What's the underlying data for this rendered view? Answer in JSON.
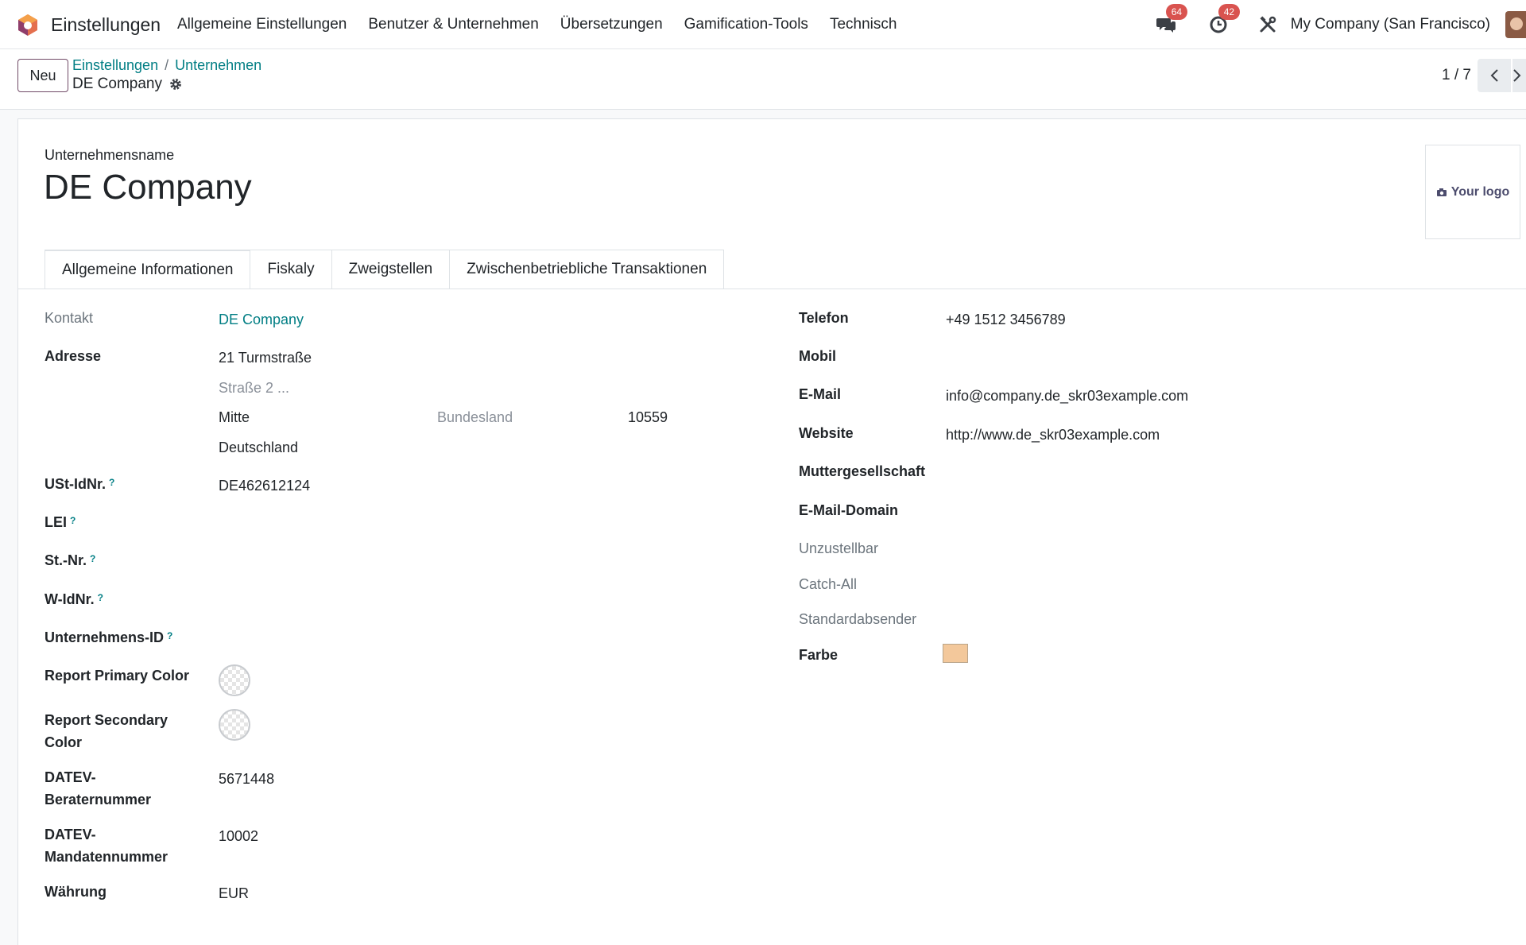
{
  "navbar": {
    "app_title": "Einstellungen",
    "menu": [
      "Allgemeine Einstellungen",
      "Benutzer & Unternehmen",
      "Übersetzungen",
      "Gamification-Tools",
      "Technisch"
    ],
    "messages_badge": "64",
    "activities_badge": "42",
    "company_switcher": "My Company (San Francisco)",
    "icons": [
      "odoo-logo-icon",
      "chat-icon",
      "clock-icon",
      "tools-icon",
      "avatar"
    ]
  },
  "control_panel": {
    "new_button": "Neu",
    "breadcrumb": [
      "Einstellungen",
      "Unternehmen"
    ],
    "breadcrumb_separator": "/",
    "record_name": "DE Company",
    "pager": "1 / 7"
  },
  "form": {
    "name_label": "Unternehmensname",
    "company_name": "DE Company",
    "logo_placeholder": "Your logo",
    "tabs": [
      "Allgemeine Informationen",
      "Fiskaly",
      "Zweigstellen",
      "Zwischenbetriebliche Transaktionen"
    ],
    "active_tab": "Allgemeine Informationen",
    "left": {
      "contact_label": "Kontakt",
      "contact_value": "DE Company",
      "address_label": "Adresse",
      "street": "21 Turmstraße",
      "street2_placeholder": "Straße 2 ...",
      "city": "Mitte",
      "state_placeholder": "Bundesland",
      "zip": "10559",
      "country": "Deutschland",
      "vat_label": "USt-IdNr.",
      "vat_value": "DE462612124",
      "lei_label": "LEI",
      "tax_number_label": "St.-Nr.",
      "w_id_label": "W-IdNr.",
      "company_id_label": "Unternehmens-ID",
      "primary_color_label": "Report Primary Color",
      "secondary_color_label": "Report Secondary Color",
      "datev_advisor_label": "DATEV-Beraternummer",
      "datev_advisor_value": "5671448",
      "datev_client_label": "DATEV-Mandatennummer",
      "datev_client_value": "10002",
      "currency_label": "Währung",
      "currency_value": "EUR",
      "help_marker": "?"
    },
    "right": {
      "phone_label": "Telefon",
      "phone_value": "+49 1512 3456789",
      "mobile_label": "Mobil",
      "email_label": "E-Mail",
      "email_value": "info@company.de_skr03example.com",
      "website_label": "Website",
      "website_value": "http://www.de_skr03example.com",
      "parent_label": "Muttergesellschaft",
      "email_domain_label": "E-Mail-Domain",
      "bounce_label": "Unzustellbar",
      "catchall_label": "Catch-All",
      "default_from_label": "Standardabsender",
      "color_label": "Farbe",
      "color_value": "#f3c89b"
    }
  },
  "colors": {
    "brand": "#714b67",
    "link": "#017e84",
    "badge": "#d9534f"
  }
}
